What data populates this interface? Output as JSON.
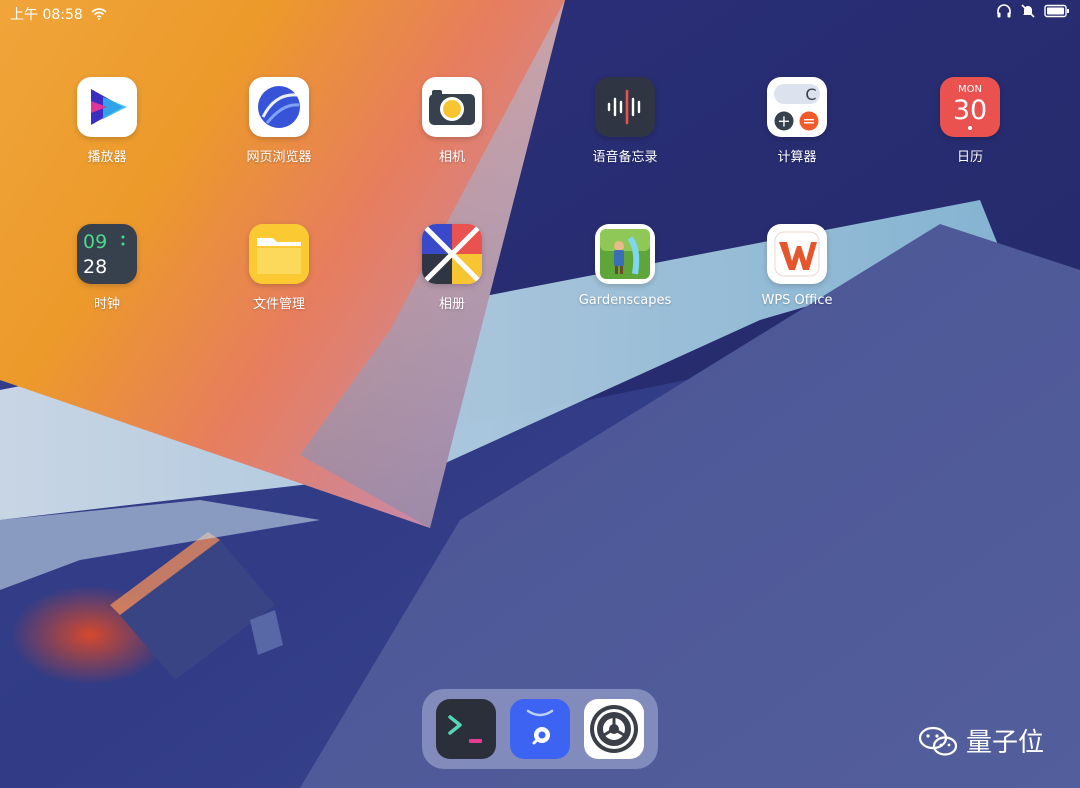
{
  "status_bar": {
    "time": "上午 08:58",
    "icons": [
      "wifi-icon",
      "headphones-icon",
      "notifications-off-icon",
      "battery-icon"
    ]
  },
  "apps": [
    {
      "label": "播放器",
      "icon": "player-icon"
    },
    {
      "label": "网页浏览器",
      "icon": "browser-icon"
    },
    {
      "label": "相机",
      "icon": "camera-icon"
    },
    {
      "label": "语音备忘录",
      "icon": "voice-memo-icon"
    },
    {
      "label": "计算器",
      "icon": "calculator-icon",
      "glyphs": {
        "clear": "C",
        "plus": "+",
        "equals": "="
      }
    },
    {
      "label": "日历",
      "icon": "calendar-icon",
      "weekday": "MON",
      "day": "30"
    },
    {
      "label": "时钟",
      "icon": "clock-icon",
      "hour": "09",
      "minute": "28"
    },
    {
      "label": "文件管理",
      "icon": "folder-icon"
    },
    {
      "label": "相册",
      "icon": "gallery-icon"
    },
    {
      "label": "Gardenscapes",
      "icon": "gardenscapes-icon"
    },
    {
      "label": "WPS Office",
      "icon": "wps-office-icon"
    }
  ],
  "dock": [
    {
      "name": "terminal",
      "icon": "terminal-icon"
    },
    {
      "name": "app-store",
      "icon": "app-store-icon"
    },
    {
      "name": "settings",
      "icon": "settings-gear-icon"
    }
  ],
  "watermark": {
    "text": "量子位",
    "icon": "wechat-icon"
  },
  "colors": {
    "wallpaper_orange": "#ec9a2a",
    "wallpaper_navy": "#2b337a",
    "calendar_red": "#e9524f",
    "wps_orange": "#e5562c",
    "clock_green": "#4cd98a",
    "dock_terminal_bg": "#2a2f3a",
    "dock_appstore_bg": "#3d63f2"
  }
}
